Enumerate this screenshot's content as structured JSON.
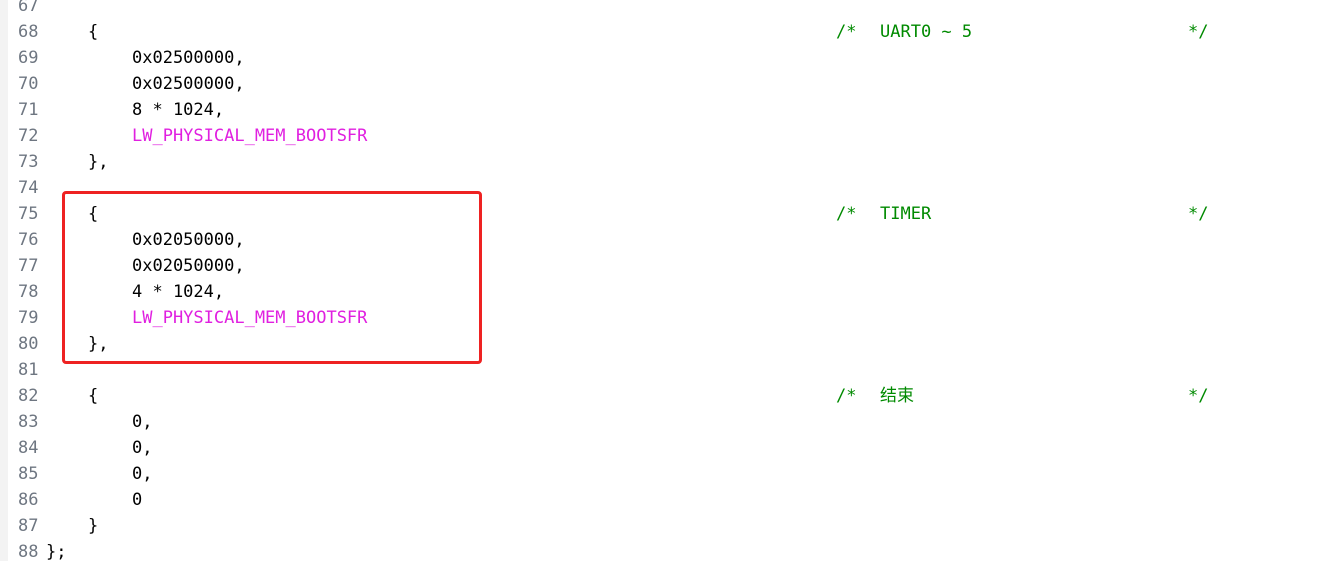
{
  "lines": [
    {
      "num": "67",
      "code": "",
      "kw": false,
      "comment": null
    },
    {
      "num": "68",
      "code": "{",
      "kw": false,
      "indent": 1,
      "comment": "UART0 ~ 5"
    },
    {
      "num": "69",
      "code": "0x02500000,",
      "kw": false,
      "indent": 2,
      "comment": null
    },
    {
      "num": "70",
      "code": "0x02500000,",
      "kw": false,
      "indent": 2,
      "comment": null
    },
    {
      "num": "71",
      "code": "8 * 1024,",
      "kw": false,
      "indent": 2,
      "comment": null
    },
    {
      "num": "72",
      "code": "LW_PHYSICAL_MEM_BOOTSFR",
      "kw": true,
      "indent": 2,
      "comment": null
    },
    {
      "num": "73",
      "code": "},",
      "kw": false,
      "indent": 1,
      "comment": null
    },
    {
      "num": "74",
      "code": "",
      "kw": false,
      "comment": null
    },
    {
      "num": "75",
      "code": "{",
      "kw": false,
      "indent": 1,
      "comment": "TIMER"
    },
    {
      "num": "76",
      "code": "0x02050000,",
      "kw": false,
      "indent": 2,
      "comment": null
    },
    {
      "num": "77",
      "code": "0x02050000,",
      "kw": false,
      "indent": 2,
      "comment": null
    },
    {
      "num": "78",
      "code": "4 * 1024,",
      "kw": false,
      "indent": 2,
      "comment": null
    },
    {
      "num": "79",
      "code": "LW_PHYSICAL_MEM_BOOTSFR",
      "kw": true,
      "indent": 2,
      "comment": null
    },
    {
      "num": "80",
      "code": "},",
      "kw": false,
      "indent": 1,
      "comment": null
    },
    {
      "num": "81",
      "code": "",
      "kw": false,
      "comment": null
    },
    {
      "num": "82",
      "code": "{",
      "kw": false,
      "indent": 1,
      "comment": "结束"
    },
    {
      "num": "83",
      "code": "0,",
      "kw": false,
      "indent": 2,
      "comment": null
    },
    {
      "num": "84",
      "code": "0,",
      "kw": false,
      "indent": 2,
      "comment": null
    },
    {
      "num": "85",
      "code": "0,",
      "kw": false,
      "indent": 2,
      "comment": null
    },
    {
      "num": "86",
      "code": "0",
      "kw": false,
      "indent": 2,
      "comment": null
    },
    {
      "num": "87",
      "code": "}",
      "kw": false,
      "indent": 1,
      "comment": null
    },
    {
      "num": "88",
      "code": "};",
      "kw": false,
      "indent": 0,
      "comment": null
    }
  ],
  "comment_open": "/*",
  "comment_close": "*/",
  "colors": {
    "keyword": "#e020e0",
    "comment": "#008a00",
    "line_number": "#6e7681",
    "highlight": "#ee2222"
  }
}
